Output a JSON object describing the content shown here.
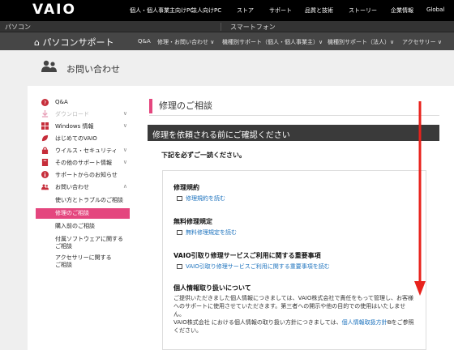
{
  "brand": {
    "logo": "VAIO"
  },
  "topnav": [
    "個人・個人事業主向けPC",
    "法人向けPC",
    "ストア",
    "サポート",
    "品質と技術",
    "ストーリー",
    "企業情報",
    "Global"
  ],
  "catbar": {
    "left": "パソコン",
    "right": "スマートフォン"
  },
  "subnav": {
    "home": "パソコンサポート",
    "items": [
      "Q&A",
      "修理・お問い合わせ ∨",
      "機種別サポート（個人・個人事業主）∨",
      "機種別サポート（法人）∨",
      "アクセサリー ∨"
    ]
  },
  "page": {
    "title": "お問い合わせ"
  },
  "sidebar": {
    "items": [
      {
        "label": "Q&A",
        "icon": "question-icon"
      },
      {
        "label": "ダウンロード",
        "icon": "download-icon"
      },
      {
        "label": "Windows 情報",
        "icon": "windows-icon"
      },
      {
        "label": "はじめてのVAIO",
        "icon": "leaf-icon"
      },
      {
        "label": "ウイルス・セキュリティ",
        "icon": "lock-icon"
      },
      {
        "label": "その他のサポート情報",
        "icon": "book-icon"
      },
      {
        "label": "サポートからのお知らせ",
        "icon": "info-icon"
      },
      {
        "label": "お問い合わせ",
        "icon": "people-icon"
      }
    ],
    "subitems": [
      "使い方とトラブルのご相談",
      "修理のご相談",
      "購入前のご相談",
      "付属ソフトウェアに関する",
      "ご相談",
      "アクセサリーに関する",
      "ご相談"
    ]
  },
  "content": {
    "section_title": "修理のご相談",
    "banner": "修理を依頼される前にご確認ください",
    "notice": "下記を必ずご一読ください。",
    "blocks": [
      {
        "heading": "修理規約",
        "link": "修理規約を読む"
      },
      {
        "heading": "無料修理規定",
        "link": "無料修理規定を読む"
      },
      {
        "heading": "VAIO引取り修理サービスご利用に関する重要事項",
        "link": "VAIO引取り修理サービスご利用に関する重要事項を読む"
      }
    ],
    "privacy_heading": "個人情報取り扱いについて",
    "privacy_p1": "ご提供いただきました個人情報につきましては、VAIO株式会社で責任をもって管理し、お客様",
    "privacy_p2": "へのサポートに使用させていただきます。第三者への開示や他の目的での使用はいたしません。",
    "privacy_p3": "VAIO株式会社 における個人情報の取り扱い方針につきましては、",
    "privacy_link": "個人情報取扱方針",
    "privacy_p4": "をご参照",
    "privacy_p5": "ください。"
  },
  "colors": {
    "accent": "#e4467e",
    "arrow": "#e8221c",
    "link": "#1e73be"
  }
}
